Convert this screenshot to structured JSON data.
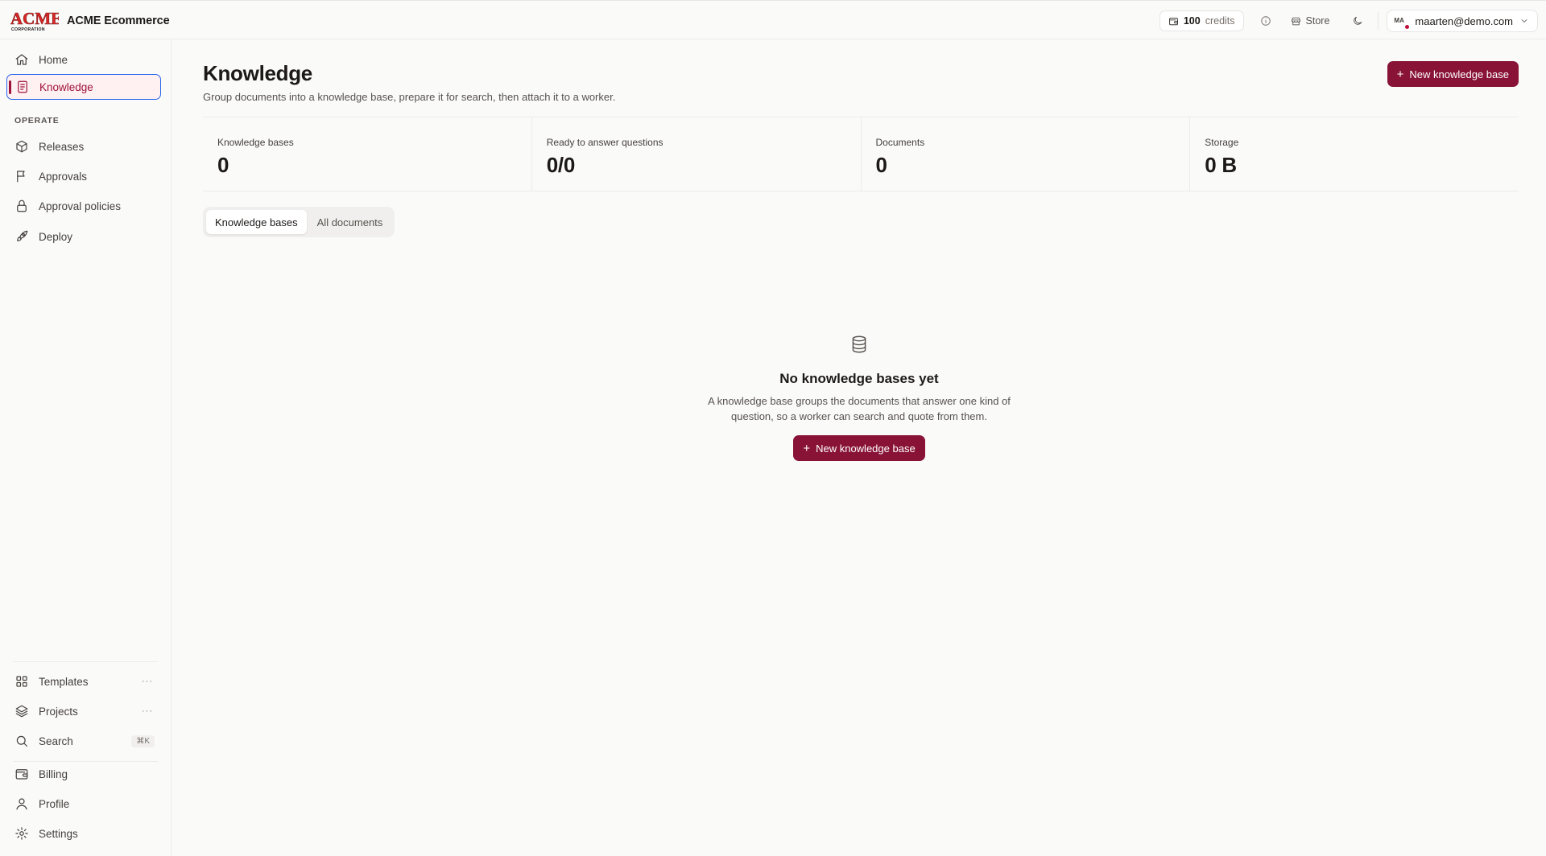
{
  "brand": {
    "logo_text": "ACME",
    "logo_subtext": "CORPORATION",
    "name": "ACME Ecommerce"
  },
  "topbar": {
    "credits_value": "100",
    "credits_label": "credits",
    "store_label": "Store",
    "user_initials": "MA",
    "user_email": "maarten@demo.com"
  },
  "sidebar": {
    "top_items": [
      {
        "label": "Home",
        "icon": "home-icon"
      },
      {
        "label": "Knowledge",
        "icon": "document-icon",
        "active": true
      }
    ],
    "section_label": "OPERATE",
    "operate_items": [
      {
        "label": "Releases",
        "icon": "package-icon"
      },
      {
        "label": "Approvals",
        "icon": "flag-icon"
      },
      {
        "label": "Approval policies",
        "icon": "lock-icon"
      },
      {
        "label": "Deploy",
        "icon": "rocket-icon"
      }
    ],
    "bottom_items": [
      {
        "label": "Templates",
        "icon": "grid-icon",
        "more": "···"
      },
      {
        "label": "Projects",
        "icon": "layers-icon",
        "more": "···"
      },
      {
        "label": "Search",
        "icon": "search-icon",
        "shortcut": "⌘K"
      },
      {
        "label": "Billing",
        "icon": "wallet-icon"
      },
      {
        "label": "Profile",
        "icon": "user-icon"
      },
      {
        "label": "Settings",
        "icon": "gear-icon"
      }
    ]
  },
  "page": {
    "title": "Knowledge",
    "subtitle": "Group documents into a knowledge base, prepare it for search, then attach it to a worker.",
    "new_button_label": "New knowledge base"
  },
  "stats": [
    {
      "label": "Knowledge bases",
      "value": "0"
    },
    {
      "label": "Ready to answer questions",
      "value": "0/0"
    },
    {
      "label": "Documents",
      "value": "0"
    },
    {
      "label": "Storage",
      "value": "0 B"
    }
  ],
  "tabs": [
    {
      "label": "Knowledge bases",
      "active": true
    },
    {
      "label": "All documents",
      "active": false
    }
  ],
  "empty_state": {
    "icon": "database-icon",
    "title": "No knowledge bases yet",
    "description": "A knowledge base groups the documents that answer one kind of question, so a worker can search and quote from them.",
    "button_label": "New knowledge base"
  },
  "colors": {
    "accent": "#881337",
    "active_bg": "#fff1f2",
    "focus_ring": "#2563eb"
  }
}
